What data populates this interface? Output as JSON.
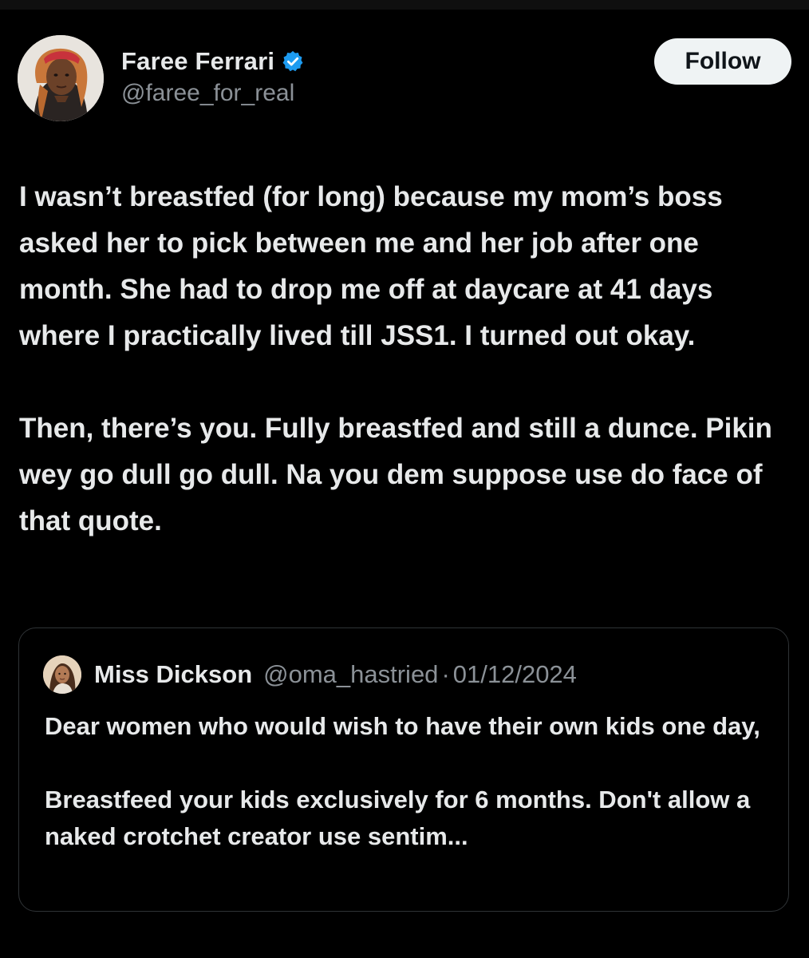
{
  "author": {
    "display_name": "Faree Ferrari",
    "handle": "@faree_for_real",
    "verified_icon": "verified-badge-icon",
    "verified_color": "#1d9bf0"
  },
  "actions": {
    "follow_label": "Follow"
  },
  "tweet": {
    "paragraphs": [
      "I wasn’t breastfed (for long) because my mom’s boss asked her to pick between me and her job after one month. She had to drop me off at daycare at 41 days where I practically lived till JSS1. I turned out okay.",
      "Then, there’s you. Fully breastfed and still a dunce. Pikin wey go dull go dull. Na you dem suppose use do face of that quote."
    ]
  },
  "quoted_tweet": {
    "display_name": "Miss Dickson",
    "handle": "@oma_hastried",
    "separator": "·",
    "date": "01/12/2024",
    "paragraphs": [
      "Dear women who would wish to have their own kids one day,",
      "Breastfeed your kids exclusively for 6 months. Don't allow a naked crotchet creator use sentim..."
    ]
  },
  "colors": {
    "background": "#000000",
    "text_primary": "#e7e9ea",
    "text_secondary": "#8b9197",
    "border": "#2f3336",
    "follow_bg": "#eff3f4"
  }
}
